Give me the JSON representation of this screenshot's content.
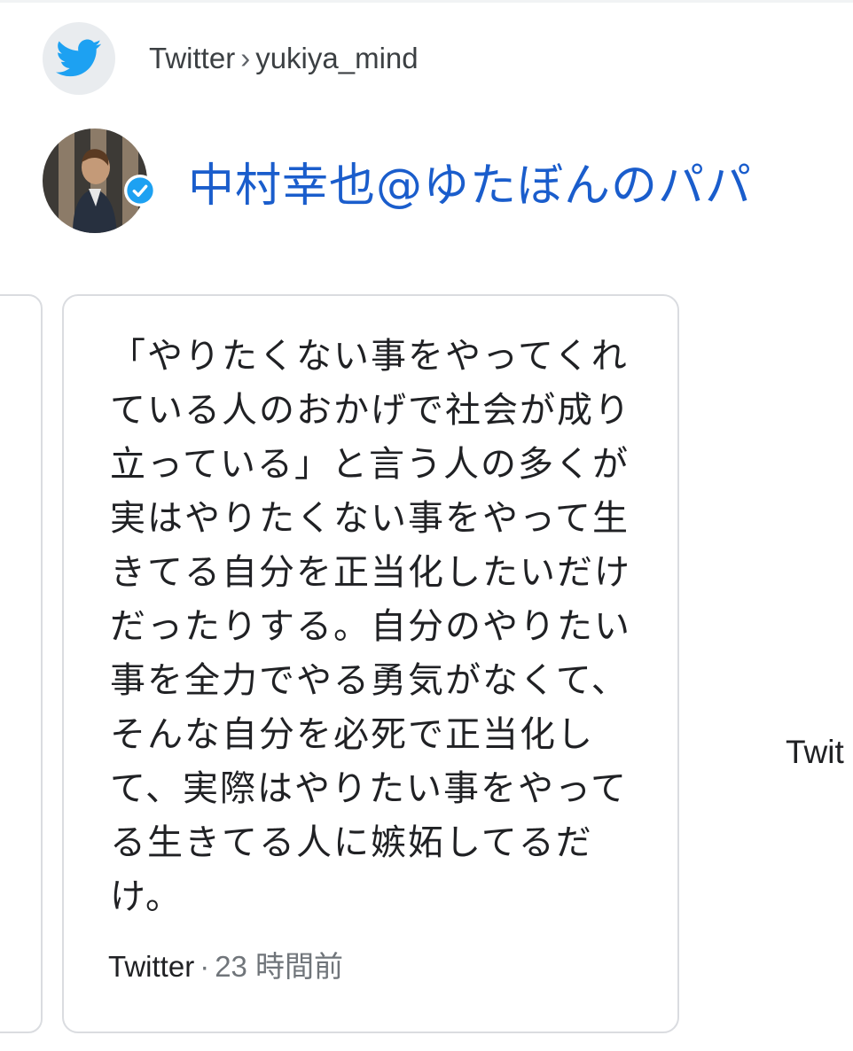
{
  "header": {
    "source_icon": "twitter-bird-icon",
    "breadcrumb_source": "Twitter",
    "breadcrumb_separator": "›",
    "breadcrumb_handle": "yukiya_mind"
  },
  "profile": {
    "name": "中村幸也@ゆたぼんのパパ",
    "verified_icon": "verified-badge-icon"
  },
  "tweet": {
    "text_lines": [
      "「やりたくない事をやってくれ",
      "ている人のおかげで社会が成り",
      "立っている」と言う人の多くが",
      "実はやりたくない事をやって生",
      "きてる自分を正当化したいだけ",
      "だったりする。自分のやりたい",
      "事を全力でやる勇気がなくて、",
      "そんな自分を必死で正当化し",
      "て、実際はやりたい事をやって",
      "る生きてる人に嫉妬してるだ",
      "け。"
    ],
    "source": "Twitter",
    "separator": "·",
    "time": "23 時間前"
  },
  "next_card_peek": "Twit",
  "colors": {
    "twitter_blue": "#1da1f2",
    "name_blue": "#1a5dcc",
    "border": "#dadce0",
    "muted_text": "#70757a"
  }
}
